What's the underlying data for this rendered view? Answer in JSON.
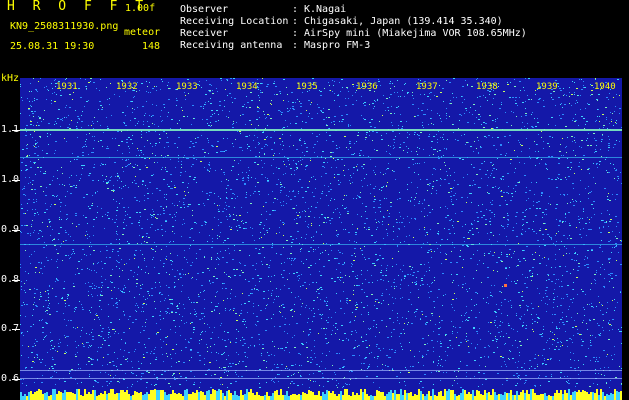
{
  "header": {
    "brand": "H R O F F T",
    "version": "1.00f",
    "filename": "KN9_2508311930.png",
    "meteor_label": "meteor",
    "datetime": "25.08.31 19:30",
    "meteor_count": "148"
  },
  "info": [
    {
      "label": "Observer",
      "value": "K.Nagai"
    },
    {
      "label": "Receiving Location",
      "value": "Chigasaki, Japan (139.414 35.340)"
    },
    {
      "label": "Receiver",
      "value": "AirSpy mini (Miakejima VOR 108.65MHz)"
    },
    {
      "label": "Receiving antenna",
      "value": "Maspro FM-3"
    }
  ],
  "info_separator": ":",
  "plot": {
    "unit": "kHz",
    "y_ticks": [
      "1.1",
      "1.0",
      "0.9",
      "0.8",
      "0.7",
      "0.6"
    ],
    "x_ticks": [
      "1931",
      "1932",
      "1933",
      "1934",
      "1935",
      "1936",
      "1937",
      "1938",
      "1939",
      "1940"
    ],
    "colors": {
      "background": "#1418a8",
      "noise": [
        "#2a8cff",
        "#3cd2ff",
        "#7ff0c0",
        "#c8ff60"
      ],
      "floor": "#ffff20"
    }
  }
}
